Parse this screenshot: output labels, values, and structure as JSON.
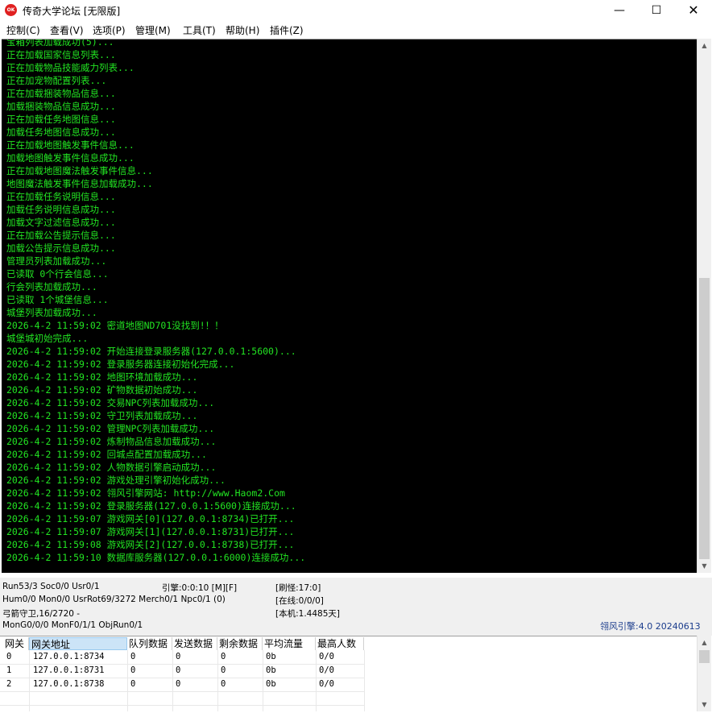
{
  "window": {
    "icon_text": "OK",
    "title": "传奇大学论坛 [无限版]",
    "min_glyph": "—",
    "max_glyph": "☐",
    "close_glyph": "✕"
  },
  "menu": [
    "控制(C)",
    "查看(V)",
    "选项(P)",
    "管理(M)",
    "工具(T)",
    "帮助(H)",
    "插件(Z)"
  ],
  "console": {
    "text_color": "#22e422",
    "lines": [
      "宝箱列表加载成功(5)...",
      "正在加载国家信息列表...",
      "正在加载物品技能威力列表...",
      "正在加宠物配置列表...",
      "正在加载捆装物品信息...",
      "加载捆装物品信息成功...",
      "正在加载任务地图信息...",
      "加载任务地图信息成功...",
      "正在加载地图触发事件信息...",
      "加载地图触发事件信息成功...",
      "正在加载地图魔法触发事件信息...",
      "地图魔法触发事件信息加载成功...",
      "正在加载任务说明信息...",
      "加载任务说明信息成功...",
      "加载文字过滤信息成功...",
      "正在加载公告提示信息...",
      "加载公告提示信息成功...",
      "管理员列表加载成功...",
      "已读取 0个行会信息...",
      "行会列表加载成功...",
      "已读取 1个城堡信息...",
      "城堡列表加载成功...",
      "2026-4-2 11:59:02 密道地图ND701没找到!！！",
      "城堡城初始完成...",
      "2026-4-2 11:59:02 开始连接登录服务器(127.0.0.1:5600)...",
      "2026-4-2 11:59:02 登录服务器连接初始化完成...",
      "2026-4-2 11:59:02 地图环境加载成功...",
      "2026-4-2 11:59:02 矿物数据初始成功...",
      "2026-4-2 11:59:02 交易NPC列表加载成功...",
      "2026-4-2 11:59:02 守卫列表加载成功...",
      "2026-4-2 11:59:02 管理NPC列表加载成功...",
      "2026-4-2 11:59:02 炼制物品信息加载成功...",
      "2026-4-2 11:59:02 回城点配置加载成功...",
      "2026-4-2 11:59:02 人物数据引擎启动成功...",
      "2026-4-2 11:59:02 游戏处理引擎初始化成功...",
      "2026-4-2 11:59:02 翎风引擎网站: http://www.Haom2.Com",
      "2026-4-2 11:59:02 登录服务器(127.0.0.1:5600)连接成功...",
      "2026-4-2 11:59:07 游戏网关[0](127.0.0.1:8734)已打开...",
      "2026-4-2 11:59:07 游戏网关[1](127.0.0.1:8731)已打开...",
      "2026-4-2 11:59:08 游戏网关[2](127.0.0.1:8738)已打开...",
      "2026-4-2 11:59:10 数据库服务器(127.0.0.1:6000)连接成功..."
    ]
  },
  "status": {
    "run": "Run53/3 Soc0/0 Usr0/1",
    "engine": "引擎:0:0:10 [M][F]",
    "refresh": "[刷怪:17:0]",
    "hum": "Hum0/0 Mon0/0 UsrRot69/3272 Merch0/1 Npc0/1 (0)",
    "online": "[在线:0/0/0]",
    "guard": "弓箭守卫,16/2720 -",
    "local": "[本机:1.4485天]",
    "mong": "MonG0/0/0 MonF0/1/1 ObjRun0/1",
    "version": "翎风引擎:4.0 20240613"
  },
  "gateway_table": {
    "headers": [
      "网关",
      "网关地址",
      "队列数据",
      "发送数据",
      "剩余数据",
      "平均流量",
      "最高人数"
    ],
    "rows": [
      [
        "0",
        "127.0.0.1:8734",
        "0",
        "0",
        "0",
        "0b",
        "0/0"
      ],
      [
        "1",
        "127.0.0.1:8731",
        "0",
        "0",
        "0",
        "0b",
        "0/0"
      ],
      [
        "2",
        "127.0.0.1:8738",
        "0",
        "0",
        "0",
        "0b",
        "0/0"
      ]
    ]
  }
}
